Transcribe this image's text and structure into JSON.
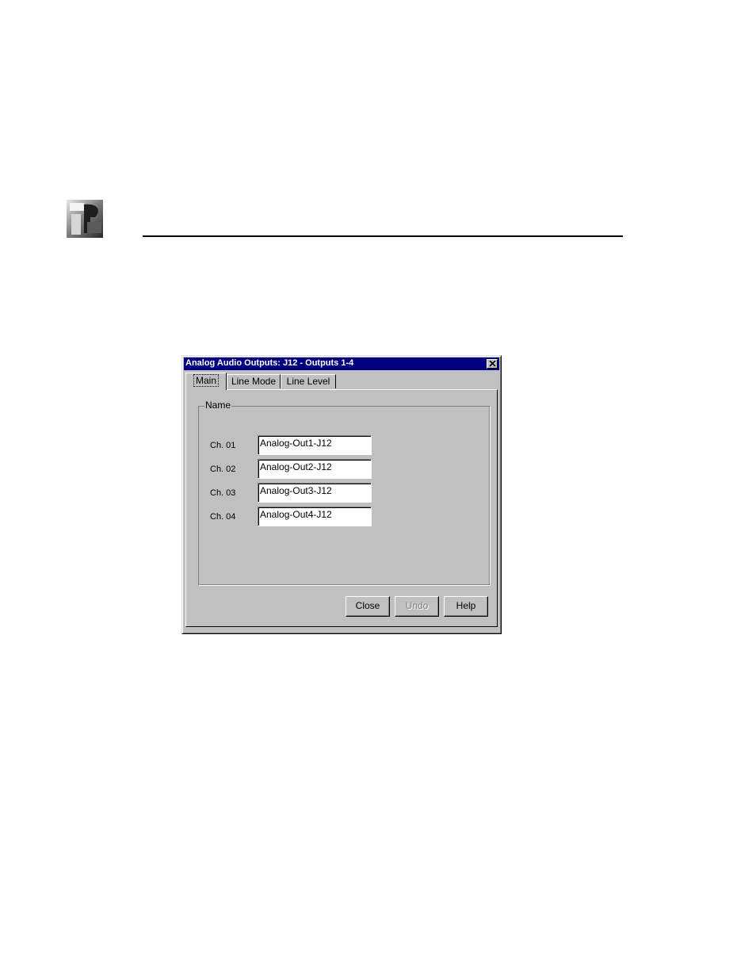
{
  "page": {
    "logo_icon": "company-logo-icon"
  },
  "dialog": {
    "title": "Analog Audio Outputs: J12 - Outputs 1-4",
    "close_icon": "close-icon",
    "tabs": [
      {
        "label": "Main",
        "active": true
      },
      {
        "label": "Line Mode",
        "active": false
      },
      {
        "label": "Line Level",
        "active": false
      }
    ],
    "group_label": "Name",
    "channels": [
      {
        "label": "Ch. 01",
        "value": "Analog-Out1-J12"
      },
      {
        "label": "Ch. 02",
        "value": "Analog-Out2-J12"
      },
      {
        "label": "Ch. 03",
        "value": "Analog-Out3-J12"
      },
      {
        "label": "Ch. 04",
        "value": "Analog-Out4-J12"
      }
    ],
    "buttons": {
      "close": "Close",
      "undo": "Undo",
      "help": "Help"
    },
    "undo_disabled": true
  }
}
